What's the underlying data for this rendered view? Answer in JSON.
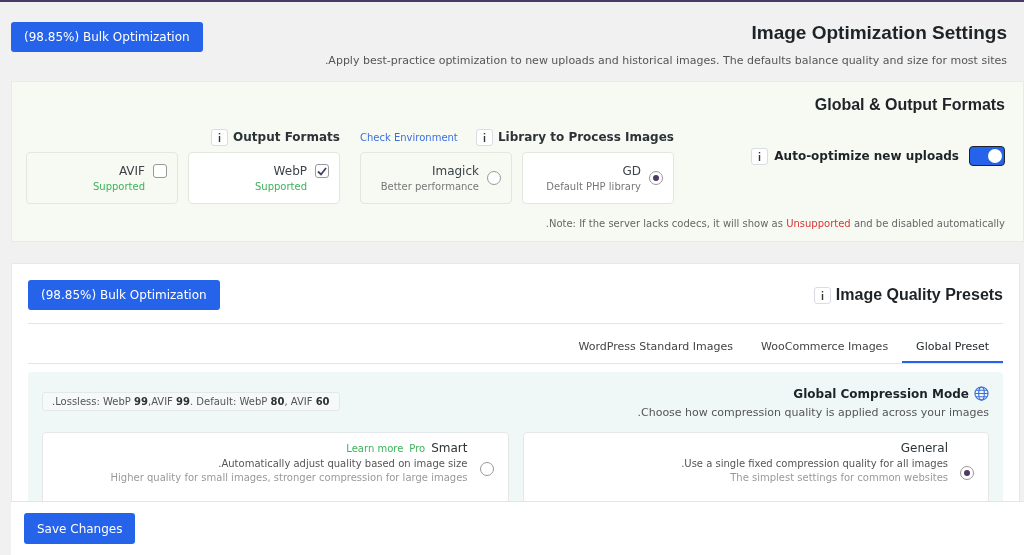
{
  "header": {
    "bulk_button": "(98.85%) Bulk Optimization",
    "title": "Image Optimization Settings",
    "subtitle": ".Apply best-practice optimization to new uploads and historical images. The defaults balance quality and size for most sites"
  },
  "global_panel": {
    "title": "Global & Output Formats",
    "output_formats": {
      "label": "Output Formats",
      "formats": [
        {
          "name": "AVIF",
          "status": "Supported",
          "checked": false
        },
        {
          "name": "WebP",
          "status": "Supported",
          "checked": true
        }
      ]
    },
    "check_environment": "Check Environment",
    "library": {
      "label": "Library to Process Images",
      "options": [
        {
          "name": "Imagick",
          "desc": "Better performance",
          "selected": false
        },
        {
          "name": "GD",
          "desc": "Default PHP library",
          "selected": true
        }
      ]
    },
    "auto_optimize": {
      "label": "Auto-optimize new uploads",
      "on": true
    },
    "note": {
      "before": ".Note: If the server lacks codecs, it will show as",
      "highlight": "Unsupported",
      "after": "and be disabled automatically"
    }
  },
  "presets_panel": {
    "bulk_button": "(98.85%) Bulk Optimization",
    "title": "Image Quality Presets",
    "tabs": [
      {
        "label": "WordPress Standard Images",
        "selected": false
      },
      {
        "label": "WooCommerce Images",
        "selected": false
      },
      {
        "label": "Global Preset",
        "selected": true
      }
    ],
    "compression": {
      "title": "Global Compression Mode",
      "subtitle": ".Choose how compression quality is applied across your images",
      "hint": ".Lossless: WebP **99**,AVIF **99**. Default: WebP **80**, AVIF **60**",
      "modes": [
        {
          "name": "Smart",
          "link": "Learn more",
          "badge": "Pro",
          "lines": [
            ".Automatically adjust quality based on image size",
            "Higher quality for small images, stronger compression for large images"
          ],
          "selected": false
        },
        {
          "name": "General",
          "lines": [
            ".Use a single fixed compression quality for all images",
            "The simplest settings for common websites"
          ],
          "selected": true
        }
      ]
    }
  },
  "save_button": "Save Changes"
}
